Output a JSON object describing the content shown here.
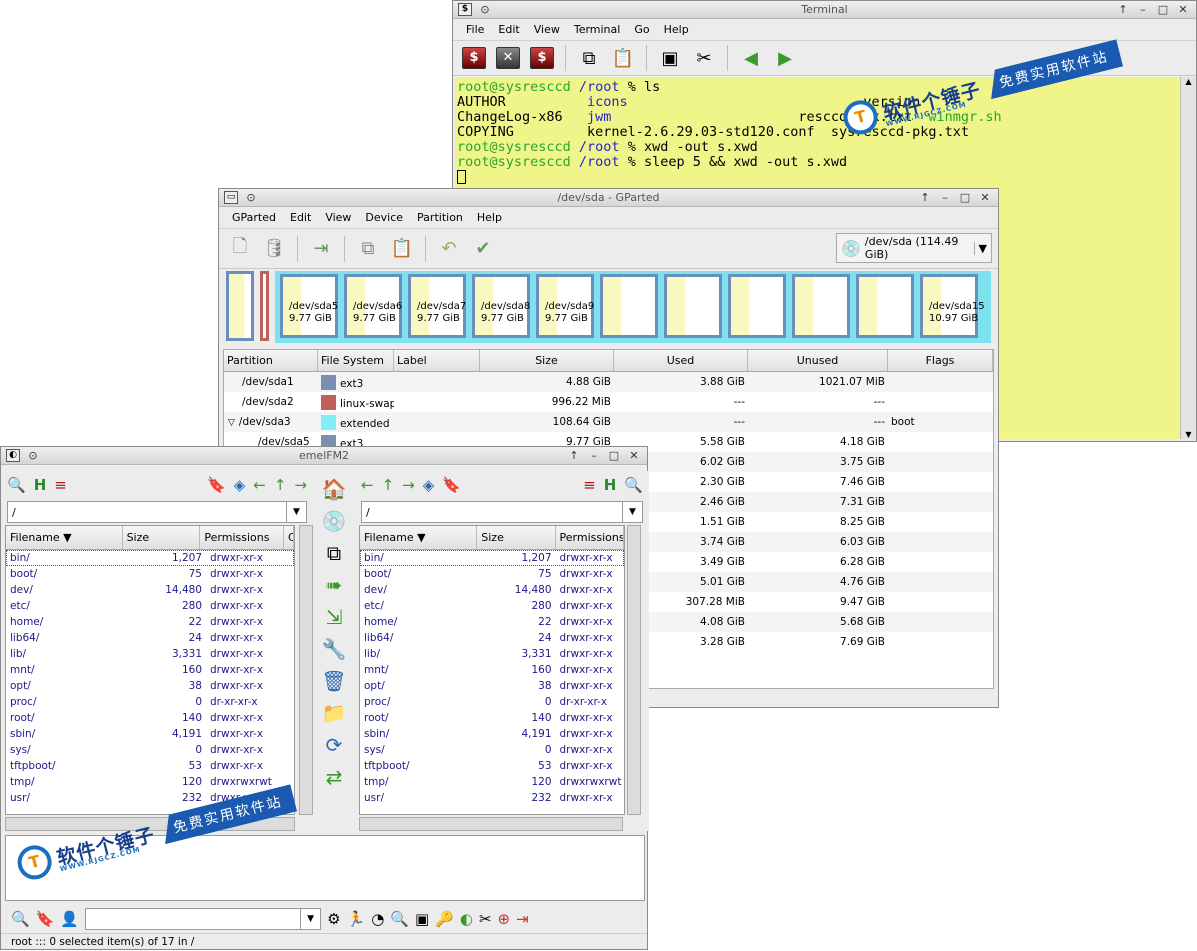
{
  "terminal": {
    "title": "Terminal",
    "menu": [
      "File",
      "Edit",
      "View",
      "Terminal",
      "Go",
      "Help"
    ],
    "lines": [
      [
        {
          "t": "root@sysresccd",
          "c": "green"
        },
        {
          "t": " /root",
          "c": "blue"
        },
        {
          "t": " % ls",
          "c": ""
        }
      ],
      [
        {
          "t": "AUTHOR          ",
          "c": ""
        },
        {
          "t": "icons",
          "c": "blue"
        },
        {
          "t": "                             version",
          "c": ""
        }
      ],
      [
        {
          "t": "ChangeLog-x86   ",
          "c": ""
        },
        {
          "t": "jwm",
          "c": "blue"
        },
        {
          "t": "                       resccd-eix.txt  ",
          "c": ""
        },
        {
          "t": "winmgr.sh",
          "c": "green"
        }
      ],
      [
        {
          "t": "COPYING         kernel-2.6.29.03-std120.conf  sysresccd-pkg.txt",
          "c": ""
        }
      ],
      [
        {
          "t": "root@sysresccd",
          "c": "green"
        },
        {
          "t": " /root",
          "c": "blue"
        },
        {
          "t": " % xwd -out s.xwd",
          "c": ""
        }
      ],
      [
        {
          "t": "root@sysresccd",
          "c": "green"
        },
        {
          "t": " /root",
          "c": "blue"
        },
        {
          "t": " % sleep 5 && xwd -out s.xwd",
          "c": ""
        }
      ]
    ]
  },
  "gparted": {
    "title": "/dev/sda - GParted",
    "menu": [
      "GParted",
      "Edit",
      "View",
      "Device",
      "Partition",
      "Help"
    ],
    "device": "/dev/sda   (114.49 GiB)",
    "disk_labels": [
      [
        "/dev/sda5",
        "9.77 GiB"
      ],
      [
        "/dev/sda6",
        "9.77 GiB"
      ],
      [
        "/dev/sda7",
        "9.77 GiB"
      ],
      [
        "/dev/sda8",
        "9.77 GiB"
      ],
      [
        "/dev/sda9",
        "9.77 GiB"
      ],
      [
        "/dev/sda15",
        "10.97 GiB"
      ]
    ],
    "columns": [
      "Partition",
      "File System",
      "Label",
      "Size",
      "Used",
      "Unused",
      "Flags"
    ],
    "rows": [
      {
        "p": "/dev/sda1",
        "fs": "ext3",
        "color": "#7b8fb0",
        "size": "4.88 GiB",
        "used": "3.88 GiB",
        "unused": "1021.07 MiB",
        "flags": ""
      },
      {
        "p": "/dev/sda2",
        "fs": "linux-swap",
        "color": "#c0605a",
        "size": "996.22 MiB",
        "used": "---",
        "unused": "---",
        "flags": ""
      },
      {
        "p": "/dev/sda3",
        "fs": "extended",
        "color": "#80f0f8",
        "size": "108.64 GiB",
        "used": "---",
        "unused": "---",
        "flags": "boot"
      },
      {
        "p": "/dev/sda5",
        "fs": "ext3",
        "color": "#7b8fb0",
        "size": "9.77 GiB",
        "used": "5.58 GiB",
        "unused": "4.18 GiB",
        "flags": ""
      },
      {
        "p": "",
        "fs": "",
        "color": "",
        "size": "",
        "used": "6.02 GiB",
        "unused": "3.75 GiB",
        "flags": ""
      },
      {
        "p": "",
        "fs": "",
        "color": "",
        "size": "",
        "used": "2.30 GiB",
        "unused": "7.46 GiB",
        "flags": ""
      },
      {
        "p": "",
        "fs": "",
        "color": "",
        "size": "",
        "used": "2.46 GiB",
        "unused": "7.31 GiB",
        "flags": ""
      },
      {
        "p": "",
        "fs": "",
        "color": "",
        "size": "",
        "used": "1.51 GiB",
        "unused": "8.25 GiB",
        "flags": ""
      },
      {
        "p": "",
        "fs": "",
        "color": "",
        "size": "",
        "used": "3.74 GiB",
        "unused": "6.03 GiB",
        "flags": ""
      },
      {
        "p": "",
        "fs": "",
        "color": "",
        "size": "",
        "used": "3.49 GiB",
        "unused": "6.28 GiB",
        "flags": ""
      },
      {
        "p": "",
        "fs": "",
        "color": "",
        "size": "",
        "used": "5.01 GiB",
        "unused": "4.76 GiB",
        "flags": ""
      },
      {
        "p": "",
        "fs": "",
        "color": "",
        "size": "",
        "used": "307.28 MiB",
        "unused": "9.47 GiB",
        "flags": ""
      },
      {
        "p": "",
        "fs": "",
        "color": "",
        "size": "",
        "used": "4.08 GiB",
        "unused": "5.68 GiB",
        "flags": ""
      },
      {
        "p": "",
        "fs": "",
        "color": "",
        "size": "",
        "used": "3.28 GiB",
        "unused": "7.69 GiB",
        "flags": ""
      }
    ]
  },
  "emelfm": {
    "title": "emelFM2",
    "path_left": "/",
    "path_right": "/",
    "columns": [
      "Filename",
      "Size",
      "Permissions"
    ],
    "files": [
      [
        "bin/",
        "1,207",
        "drwxr-xr-x"
      ],
      [
        "boot/",
        "75",
        "drwxr-xr-x"
      ],
      [
        "dev/",
        "14,480",
        "drwxr-xr-x"
      ],
      [
        "etc/",
        "280",
        "drwxr-xr-x"
      ],
      [
        "home/",
        "22",
        "drwxr-xr-x"
      ],
      [
        "lib64/",
        "24",
        "drwxr-xr-x"
      ],
      [
        "lib/",
        "3,331",
        "drwxr-xr-x"
      ],
      [
        "mnt/",
        "160",
        "drwxr-xr-x"
      ],
      [
        "opt/",
        "38",
        "drwxr-xr-x"
      ],
      [
        "proc/",
        "0",
        "dr-xr-xr-x"
      ],
      [
        "root/",
        "140",
        "drwxr-xr-x"
      ],
      [
        "sbin/",
        "4,191",
        "drwxr-xr-x"
      ],
      [
        "sys/",
        "0",
        "drwxr-xr-x"
      ],
      [
        "tftpboot/",
        "53",
        "drwxr-xr-x"
      ],
      [
        "tmp/",
        "120",
        "drwxrwxrwt"
      ],
      [
        "usr/",
        "232",
        "drwxr-xr-x"
      ]
    ],
    "status": "root    :::  0 selected item(s) of 17 in /"
  },
  "watermark": {
    "cn": "软件个锤子",
    "url": "WWW.RJGCZ.COM",
    "band": "免费实用软件站"
  }
}
